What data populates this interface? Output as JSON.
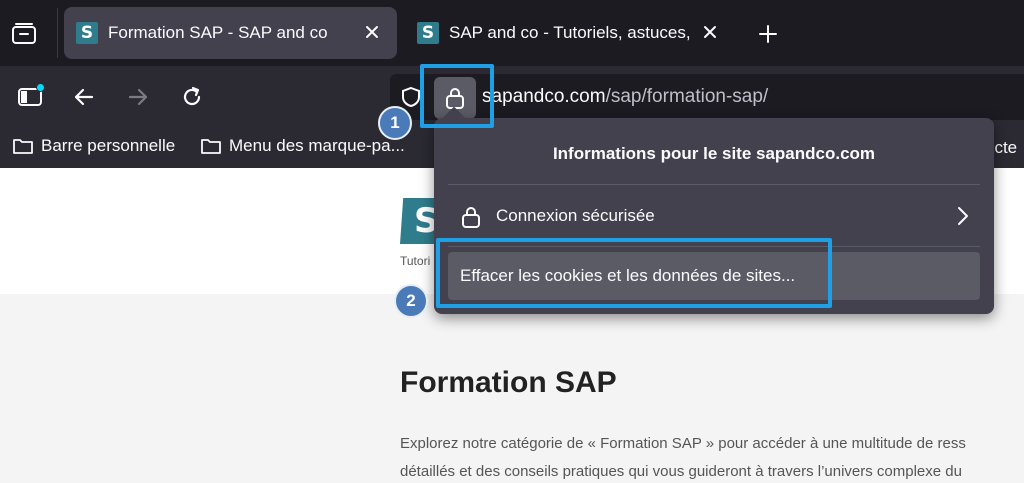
{
  "tabs": [
    {
      "favicon": "S",
      "title": "Formation SAP - SAP and co",
      "active": true
    },
    {
      "favicon": "S",
      "title": "SAP and co - Tutoriels, astuces,",
      "active": false
    }
  ],
  "icons": {
    "tab_overview": "folder-tabs-icon",
    "close": "close-icon",
    "new_tab": "plus-icon",
    "sidebar": "sidebar-icon",
    "back": "arrow-left-icon",
    "forward": "arrow-right-icon",
    "reload": "reload-icon",
    "shield": "shield-icon",
    "lock": "lock-icon",
    "folder": "folder-icon",
    "chevron": "chevron-right-icon"
  },
  "urlbar": {
    "host": "sapandco.com",
    "path": "/sap/formation-sap/"
  },
  "bookmarks": {
    "items": [
      {
        "label": "Barre personnelle"
      },
      {
        "label": "Menu des marque-pa..."
      }
    ],
    "overflow_text": "ecte"
  },
  "site_info_panel": {
    "title": "Informations pour le site sapandco.com",
    "connection_label": "Connexion sécurisée",
    "clear_cookies_label": "Effacer les cookies et les données de sites..."
  },
  "page": {
    "logo_letter": "S",
    "tagline": "Tutori",
    "title": "Formation SAP",
    "intro_lines": [
      "Explorez notre catégorie de « Formation SAP » pour accéder à une multitude de ress",
      "détaillés et des conseils pratiques qui vous guideront à travers l’univers complexe du"
    ]
  },
  "annotations": {
    "step_1": "1",
    "step_2": "2",
    "highlight_color": "#1fa0e6",
    "badge_color": "#4a7ab8"
  },
  "colors": {
    "tabstrip_bg": "#1c1b22",
    "toolbar_bg": "#2b2a33",
    "panel_bg": "#42414d",
    "brand": "#2f7d8c",
    "accent_dot": "#00ddff"
  }
}
